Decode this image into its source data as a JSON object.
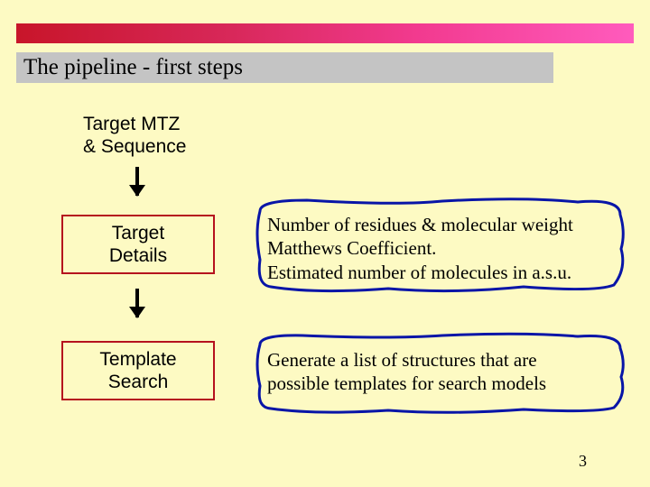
{
  "title": "The pipeline - first steps",
  "input": {
    "line1": "Target MTZ",
    "line2": "& Sequence"
  },
  "steps": [
    {
      "label_line1": "Target",
      "label_line2": "Details"
    },
    {
      "label_line1": "Template",
      "label_line2": "Search"
    }
  ],
  "callouts": [
    {
      "line1": "Number of residues & molecular weight",
      "line2": "Matthews Coefficient.",
      "line3": "Estimated number of molecules in a.s.u."
    },
    {
      "line1": "Generate a list of structures that are",
      "line2": "possible templates for search models"
    }
  ],
  "page_number": "3",
  "colors": {
    "background": "#fdfac3",
    "bar_gradient_start": "#c8152a",
    "bar_gradient_end": "#ff5bbd",
    "title_bg": "#c4c4c4",
    "step_border": "#b5111e",
    "callout_border": "#0815a7"
  }
}
